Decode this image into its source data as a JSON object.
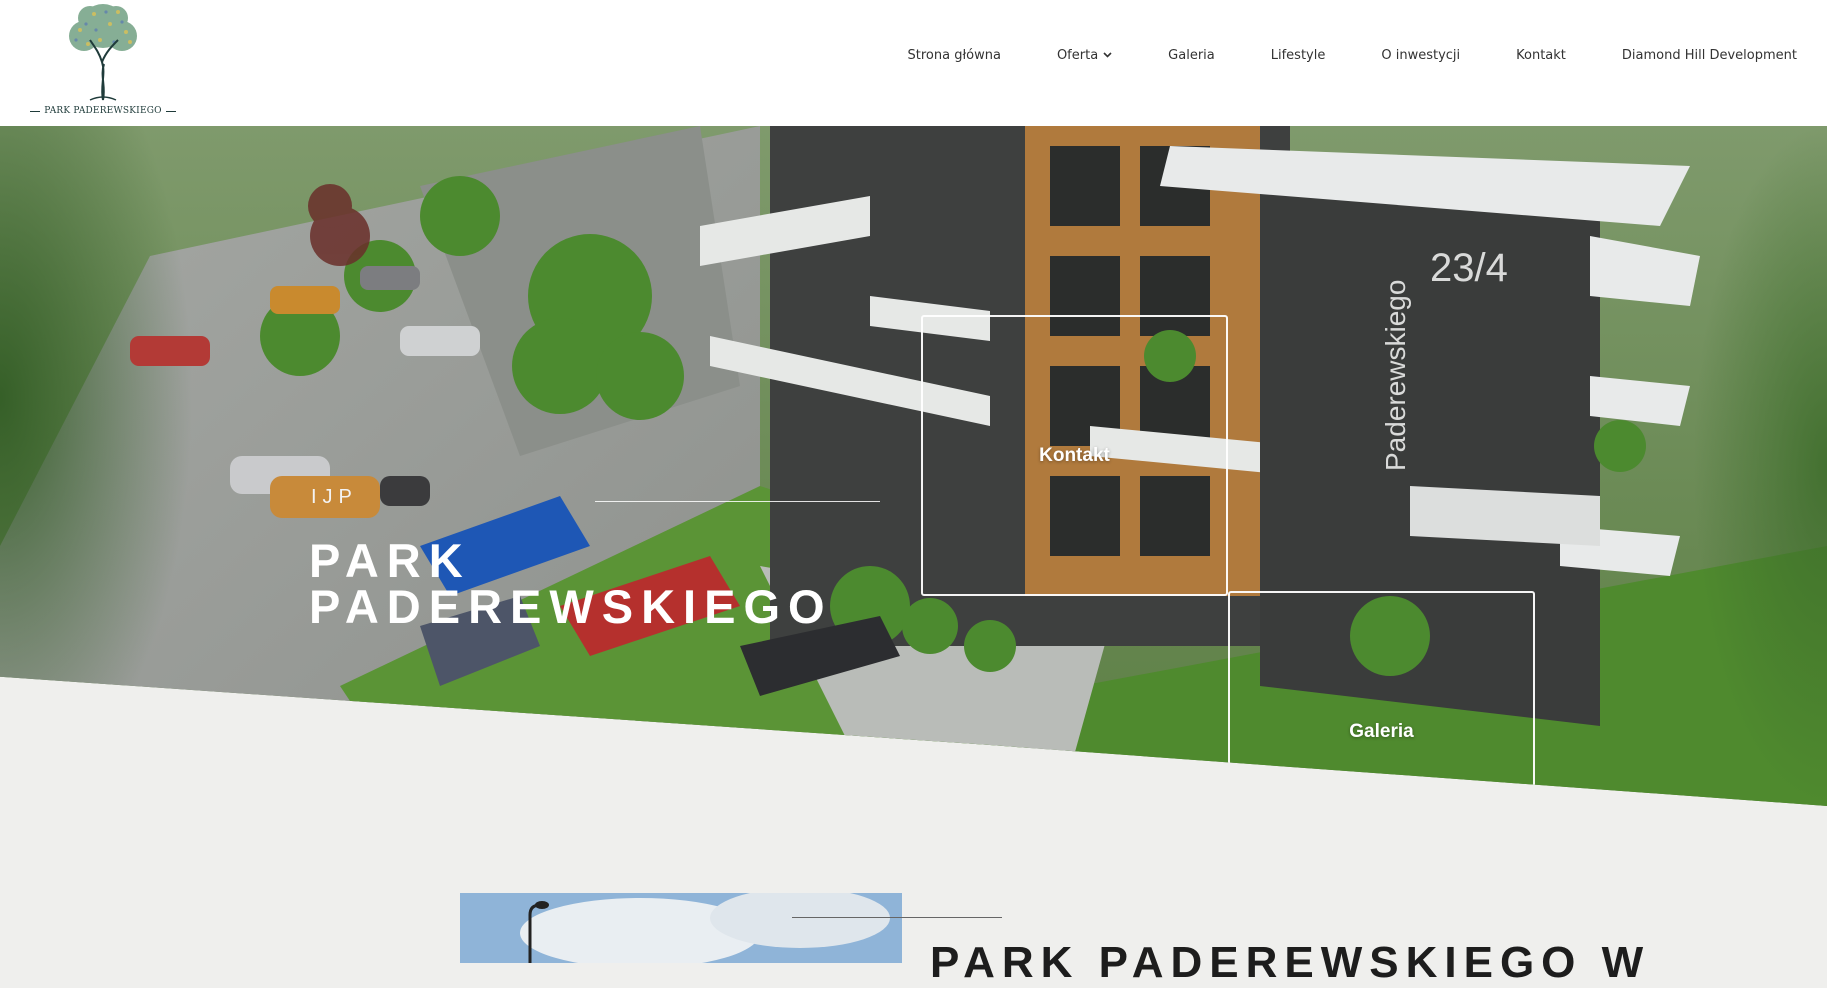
{
  "brand": {
    "name": "PARK PADEREWSKIEGO",
    "logo_icon": "tree-logo-icon"
  },
  "nav": {
    "items": [
      {
        "label": "Strona główna"
      },
      {
        "label": "Oferta",
        "icon": "chevron-down-icon"
      },
      {
        "label": "Galeria"
      },
      {
        "label": "Lifestyle"
      },
      {
        "label": "O inwestycji"
      },
      {
        "label": "Kontakt"
      },
      {
        "label": "Diamond Hill Development"
      }
    ]
  },
  "hero": {
    "eyebrow": "IJP",
    "title_line1": "PARK",
    "title_line2": "PADEREWSKIEGO",
    "building_sign_street": "Paderewskiego",
    "building_sign_number": "23/4",
    "boxes": [
      {
        "label": "Kontakt"
      },
      {
        "label": "Galeria"
      }
    ]
  },
  "intro": {
    "heading": "PARK PADEREWSKIEGO W"
  },
  "colors": {
    "logo_dark": "#1f3b3a",
    "background": "#efefed",
    "facade_dark": "#3d3f3e",
    "facade_wood": "#b07a3d",
    "grass": "#4e8a2f"
  }
}
